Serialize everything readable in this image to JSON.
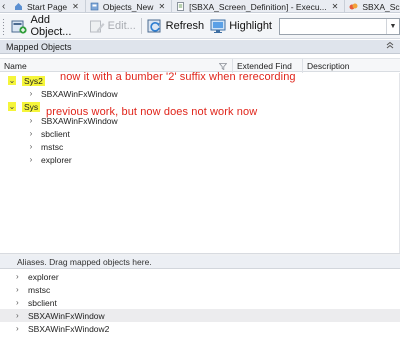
{
  "tabs": [
    {
      "label": "Start Page",
      "closable": true,
      "icon": "home-icon"
    },
    {
      "label": "Objects_New",
      "closable": true,
      "icon": "objects-icon"
    },
    {
      "label": "[SBXA_Screen_Definition] - Execu...",
      "closable": true,
      "icon": "document-icon"
    },
    {
      "label": "SBXA_Screen_Defi",
      "closable": false,
      "icon": "settings-icon"
    }
  ],
  "toolbar": {
    "add_label": "Add Object...",
    "edit_label": "Edit...",
    "refresh_label": "Refresh",
    "highlight_label": "Highlight",
    "combo_value": ""
  },
  "panel": {
    "title": "Mapped Objects"
  },
  "grid": {
    "columns": [
      "Name",
      "Extended Find",
      "Description"
    ]
  },
  "tree": {
    "sys2": {
      "label": "Sys2",
      "children": [
        "SBXAWinFxWindow"
      ]
    },
    "sys": {
      "label": "Sys",
      "children": [
        "SBXAWinFxWindow",
        "sbclient",
        "mstsc",
        "explorer"
      ]
    }
  },
  "annotations": {
    "note1": "now it with a bumber '2' suffix when rerecording",
    "note2": "previous work, but now does not work now"
  },
  "aliases": {
    "header": "Aliases. Drag mapped objects here.",
    "items": [
      "explorer",
      "mstsc",
      "sbclient",
      "SBXAWinFxWindow",
      "SBXAWinFxWindow2"
    ],
    "selected_index": 3
  },
  "colors": {
    "highlight": "#f5f53a",
    "annotation": "#e0251b",
    "panel_header": "#dfe4ec"
  }
}
